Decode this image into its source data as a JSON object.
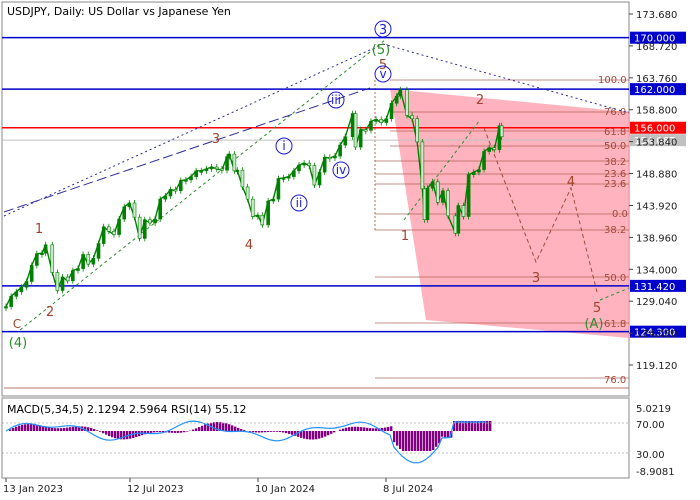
{
  "header": {
    "title": "USDJPY, Daily:  US Dollar vs Japanese Yen"
  },
  "chart_data": {
    "type": "line",
    "symbol": "USDJPY",
    "timeframe": "Daily",
    "title": "USDJPY, Daily:  US Dollar vs Japanese Yen",
    "ylim": [
      114.5,
      176.5
    ],
    "y_ticks": [
      173.68,
      168.72,
      163.76,
      158.8,
      153.84,
      148.88,
      143.92,
      138.96,
      134.0,
      129.04,
      124.08,
      119.12
    ],
    "x_ticks": [
      "13 Jan 2023",
      "12 Jul 2023",
      "10 Jan 2024",
      "8 Jul 2024"
    ],
    "series": [
      {
        "name": "",
        "points": [
          [
            "2023-01-13",
            128.2
          ],
          [
            "2023-01-20",
            129.8
          ],
          [
            "2023-01-27",
            130.5
          ],
          [
            "2023-02-03",
            131.2
          ],
          [
            "2023-02-10",
            132.1
          ],
          [
            "2023-02-17",
            134.6
          ],
          [
            "2023-02-24",
            136.4
          ],
          [
            "2023-03-03",
            136.5
          ],
          [
            "2023-03-08",
            137.8
          ],
          [
            "2023-03-17",
            133.5
          ],
          [
            "2023-03-24",
            130.7
          ],
          [
            "2023-03-31",
            132.8
          ],
          [
            "2023-04-07",
            132.2
          ],
          [
            "2023-04-14",
            133.8
          ],
          [
            "2023-04-21",
            134.1
          ],
          [
            "2023-04-28",
            136.3
          ],
          [
            "2023-05-05",
            134.8
          ],
          [
            "2023-05-12",
            135.7
          ],
          [
            "2023-05-19",
            138.0
          ],
          [
            "2023-05-26",
            140.6
          ],
          [
            "2023-06-02",
            139.9
          ],
          [
            "2023-06-09",
            139.4
          ],
          [
            "2023-06-16",
            141.8
          ],
          [
            "2023-06-23",
            143.7
          ],
          [
            "2023-06-30",
            144.3
          ],
          [
            "2023-07-07",
            142.1
          ],
          [
            "2023-07-14",
            138.8
          ],
          [
            "2023-07-21",
            141.7
          ],
          [
            "2023-07-28",
            141.2
          ],
          [
            "2023-08-04",
            141.8
          ],
          [
            "2023-08-11",
            144.9
          ],
          [
            "2023-08-18",
            145.4
          ],
          [
            "2023-08-25",
            146.4
          ],
          [
            "2023-09-01",
            146.2
          ],
          [
            "2023-09-08",
            147.8
          ],
          [
            "2023-09-15",
            147.9
          ],
          [
            "2023-09-22",
            148.4
          ],
          [
            "2023-09-29",
            149.3
          ],
          [
            "2023-10-06",
            149.3
          ],
          [
            "2023-10-13",
            149.6
          ],
          [
            "2023-10-20",
            149.9
          ],
          [
            "2023-10-27",
            149.6
          ],
          [
            "2023-11-03",
            149.4
          ],
          [
            "2023-11-10",
            151.5
          ],
          [
            "2023-11-13",
            151.9
          ],
          [
            "2023-11-20",
            149.3
          ],
          [
            "2023-11-24",
            149.4
          ],
          [
            "2023-12-01",
            146.8
          ],
          [
            "2023-12-08",
            144.9
          ],
          [
            "2023-12-15",
            142.2
          ],
          [
            "2023-12-22",
            142.4
          ],
          [
            "2023-12-28",
            140.9
          ],
          [
            "2024-01-05",
            144.6
          ],
          [
            "2024-01-12",
            144.9
          ],
          [
            "2024-01-19",
            148.1
          ],
          [
            "2024-01-26",
            148.2
          ],
          [
            "2024-02-02",
            148.4
          ],
          [
            "2024-02-09",
            149.3
          ],
          [
            "2024-02-16",
            150.2
          ],
          [
            "2024-02-23",
            150.5
          ],
          [
            "2024-03-01",
            150.1
          ],
          [
            "2024-03-08",
            147.1
          ],
          [
            "2024-03-15",
            149.1
          ],
          [
            "2024-03-22",
            151.4
          ],
          [
            "2024-03-29",
            151.3
          ],
          [
            "2024-04-05",
            151.6
          ],
          [
            "2024-04-12",
            153.3
          ],
          [
            "2024-04-19",
            154.6
          ],
          [
            "2024-04-29",
            158.2
          ],
          [
            "2024-05-03",
            153.0
          ],
          [
            "2024-05-10",
            155.7
          ],
          [
            "2024-05-17",
            155.6
          ],
          [
            "2024-05-24",
            157.0
          ],
          [
            "2024-05-31",
            157.3
          ],
          [
            "2024-06-07",
            156.8
          ],
          [
            "2024-06-14",
            157.4
          ],
          [
            "2024-06-21",
            159.8
          ],
          [
            "2024-06-28",
            160.9
          ],
          [
            "2024-07-03",
            161.9
          ],
          [
            "2024-07-12",
            157.9
          ],
          [
            "2024-07-19",
            157.4
          ],
          [
            "2024-07-26",
            153.8
          ],
          [
            "2024-08-02",
            146.5
          ],
          [
            "2024-08-05",
            141.7
          ],
          [
            "2024-08-09",
            146.6
          ],
          [
            "2024-08-16",
            147.6
          ],
          [
            "2024-08-23",
            144.4
          ],
          [
            "2024-08-30",
            146.2
          ],
          [
            "2024-09-06",
            142.3
          ],
          [
            "2024-09-16",
            139.6
          ],
          [
            "2024-09-20",
            143.9
          ],
          [
            "2024-09-27",
            142.2
          ],
          [
            "2024-10-04",
            148.7
          ],
          [
            "2024-10-11",
            149.1
          ],
          [
            "2024-10-18",
            149.5
          ],
          [
            "2024-10-25",
            152.3
          ],
          [
            "2024-11-01",
            152.9
          ],
          [
            "2024-11-08",
            152.6
          ],
          [
            "2024-11-15",
            156.3
          ],
          [
            "2024-11-18",
            154.6
          ]
        ]
      }
    ],
    "horizontal_levels": [
      {
        "label": "170.000",
        "value": 170.0,
        "color": "#0000cc"
      },
      {
        "label": "162.000",
        "value": 162.0,
        "color": "#0000cc"
      },
      {
        "label": "156.000",
        "value": 156.0,
        "color": "#ff0000"
      },
      {
        "label": "154.067",
        "value": 154.067,
        "color": "#c0c0c0"
      },
      {
        "label": "131.420",
        "value": 131.42,
        "color": "#0000cc"
      },
      {
        "label": "124.300",
        "value": 124.3,
        "color": "#0000cc"
      }
    ],
    "fib_labels": [
      "100.0",
      "76.0",
      "61.8",
      "50.0",
      "38.2",
      "23.6",
      "23.6",
      "0.0",
      "38.2",
      "50.0",
      "61.8",
      "76.0"
    ],
    "wave_labels": [
      "1",
      "2",
      "3",
      "4",
      "5",
      "1",
      "2",
      "3",
      "4",
      "5",
      "(A)",
      "(4)",
      "C",
      "(5)",
      "i",
      "ii",
      "iii",
      "iv",
      "v"
    ],
    "macd": {
      "label": "MACD(5,34,5) 2.1294 2.5964 RSI(14) 55.12",
      "y_ticks": [
        "5.0219",
        "70.00",
        "30.00",
        "-8.9081"
      ]
    },
    "colors": {
      "candle": "#008000",
      "forecast_zone": "#ff9aa8",
      "level_blue": "#0000cc",
      "level_red": "#ff0000",
      "wave_red": "#a0432f",
      "wave_blue": "#1b1bd6",
      "wave_green": "#2e8b2e",
      "macd_hist": "#800080",
      "rsi_line": "#1e90ff"
    }
  }
}
